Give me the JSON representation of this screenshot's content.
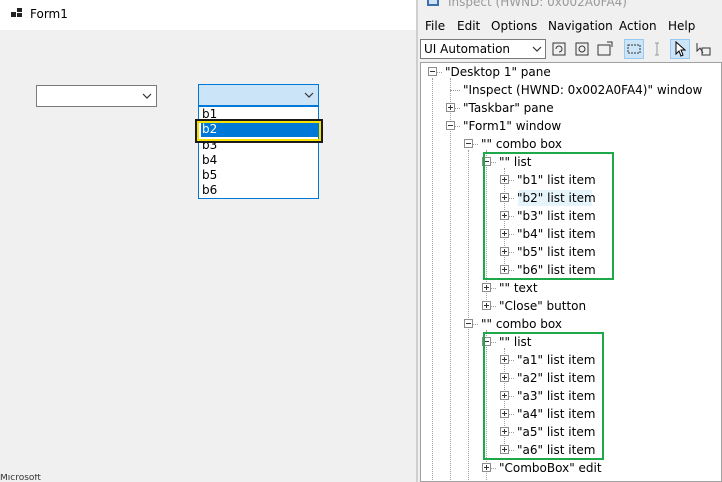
{
  "form1": {
    "title": "Form1",
    "combo_a": {
      "value": ""
    },
    "combo_b": {
      "value": "",
      "options": [
        "b1",
        "b2",
        "b3",
        "b4",
        "b5",
        "b6"
      ],
      "selected": "b2"
    },
    "bottom_text": "Microsoft"
  },
  "inspect": {
    "title": "Inspect  (HWND: 0x002A0FA4)",
    "menu": [
      "File",
      "Edit",
      "Options",
      "Navigation",
      "Action",
      "Help"
    ],
    "mode": "UI Automation",
    "tree": [
      {
        "id": "desktop",
        "label": "\"Desktop 1\" pane"
      },
      {
        "id": "inspect-window",
        "label": "\"Inspect  (HWND: 0x002A0FA4)\" window"
      },
      {
        "id": "taskbar",
        "label": "\"Taskbar\" pane"
      },
      {
        "id": "form1-window",
        "label": "\"Form1\" window"
      },
      {
        "id": "combo1",
        "label": "\"\" combo box"
      },
      {
        "id": "list1",
        "label": "\"\" list"
      },
      {
        "id": "b1",
        "label": "\"b1\" list item"
      },
      {
        "id": "b2",
        "label": "\"b2\" list item"
      },
      {
        "id": "b3",
        "label": "\"b3\" list item"
      },
      {
        "id": "b4",
        "label": "\"b4\" list item"
      },
      {
        "id": "b5",
        "label": "\"b5\" list item"
      },
      {
        "id": "b6",
        "label": "\"b6\" list item"
      },
      {
        "id": "text1",
        "label": "\"\" text"
      },
      {
        "id": "close-button",
        "label": "\"Close\" button"
      },
      {
        "id": "combo2",
        "label": "\"\" combo box"
      },
      {
        "id": "list2",
        "label": "\"\" list"
      },
      {
        "id": "a1",
        "label": "\"a1\" list item"
      },
      {
        "id": "a2",
        "label": "\"a2\" list item"
      },
      {
        "id": "a3",
        "label": "\"a3\" list item"
      },
      {
        "id": "a4",
        "label": "\"a4\" list item"
      },
      {
        "id": "a5",
        "label": "\"a5\" list item"
      },
      {
        "id": "a6",
        "label": "\"a6\" list item"
      },
      {
        "id": "combobox-edit",
        "label": "\"ComboBox\" edit"
      }
    ]
  },
  "colors": {
    "highlight_outer": "#1a1a1a",
    "highlight_inner": "#f5e000",
    "selection": "#0078d7",
    "group_box": "#1fa84a"
  }
}
